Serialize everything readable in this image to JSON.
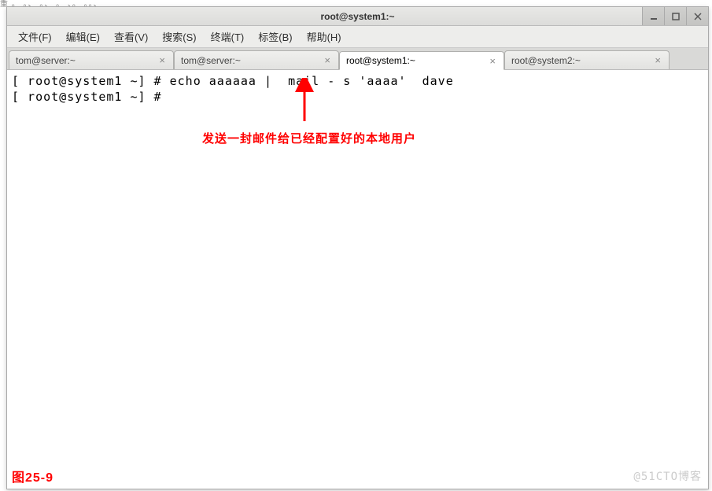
{
  "garble": "重 。   。、 。、       。 、。 。。、",
  "window": {
    "title": "root@system1:~"
  },
  "menubar": {
    "items": [
      "文件(F)",
      "编辑(E)",
      "查看(V)",
      "搜索(S)",
      "终端(T)",
      "标签(B)",
      "帮助(H)"
    ]
  },
  "tabs": [
    {
      "label": "tom@server:~",
      "active": false
    },
    {
      "label": "tom@server:~",
      "active": false
    },
    {
      "label": "root@system1:~",
      "active": true
    },
    {
      "label": "root@system2:~",
      "active": false
    }
  ],
  "terminal": {
    "line1": "[ root@system1 ~] # echo aaaaaa |  mail - s 'aaaa'  dave",
    "line2": "[ root@system1 ~] #"
  },
  "annotation": {
    "text": "发送一封邮件给已经配置好的本地用户"
  },
  "figure_label": "图25-9",
  "watermark": "@51CTO博客"
}
